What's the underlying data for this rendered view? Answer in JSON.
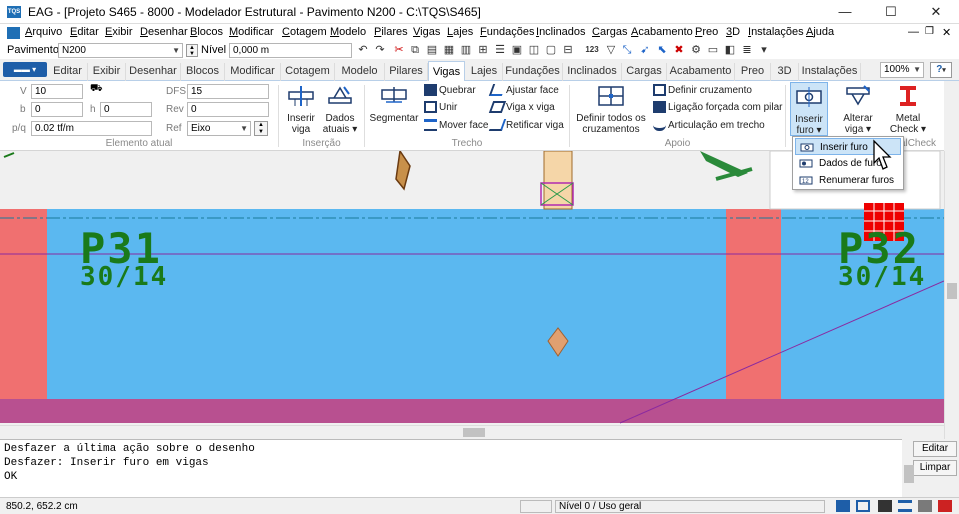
{
  "titlebar": {
    "title": "EAG - [Projeto S465 - 8000 - Modelador Estrutural - Pavimento N200 - C:\\TQS\\S465]",
    "app_icon": "TQS",
    "minimize": "—",
    "maximize": "☐",
    "close": "✕"
  },
  "menu": [
    "Arquivo",
    "Editar",
    "Exibir",
    "Desenhar",
    "Blocos",
    "Modificar",
    "Cotagem",
    "Modelo",
    "Pilares",
    "Vigas",
    "Lajes",
    "Fundações",
    "Inclinados",
    "Cargas",
    "Acabamento",
    "Preo",
    "3D",
    "Instalações",
    "Ajuda"
  ],
  "levelbar": {
    "pavimento_label": "Pavimento",
    "pavimento_value": "N200",
    "nivel_label": "Nível",
    "nivel_value": "0,000 m",
    "numbering_icon": "123"
  },
  "tabs": [
    "Editar",
    "Exibir",
    "Desenhar",
    "Blocos",
    "Modificar",
    "Cotagem",
    "Modelo",
    "Pilares",
    "Vigas",
    "Lajes",
    "Fundações",
    "Inclinados",
    "Cargas",
    "Acabamento",
    "Preo",
    "3D",
    "Instalações"
  ],
  "active_tab": "Vigas",
  "zoom": "100%",
  "help_btn": "?",
  "ribbon": {
    "elemento_atual": {
      "label": "Elemento atual",
      "v_label": "V",
      "v_value": "10",
      "b_label": "b",
      "b_value": "0",
      "h_label": "h",
      "h_value": "0",
      "pq_label": "p/q",
      "pq_value": "0.02 tf/m",
      "dfs_label": "DFS",
      "dfs_value": "15",
      "rev_label": "Rev",
      "rev_value": "0",
      "ref_label": "Ref",
      "ref_value": "Eixo"
    },
    "insercao": {
      "label": "Inserção",
      "inserir_viga": "Inserir viga",
      "dados_atuais": "Dados atuais ▾"
    },
    "trecho": {
      "label": "Trecho",
      "segmentar": "Segmentar",
      "quebrar": "Quebrar",
      "unir": "Unir",
      "mover_face": "Mover face",
      "ajustar_face": "Ajustar face",
      "viga_x_viga": "Viga x viga",
      "retificar_viga": "Retificar viga"
    },
    "apoio": {
      "label": "Apoio",
      "definir_todos": "Definir todos os cruzamentos",
      "definir_cruzamento": "Definir cruzamento",
      "ligacao_forcada": "Ligação forçada com pilar",
      "articulacao": "Articulação em trecho"
    },
    "furo": {
      "inserir_furo": "Inserir furo ▾",
      "alterar_viga": "Alterar viga ▾",
      "metal_check": "Metal Check ▾",
      "metalcheck_label": "alCheck"
    }
  },
  "dropdown": {
    "items": [
      "Inserir furo",
      "Dados de furo",
      "Renumerar furos"
    ]
  },
  "canvas": {
    "pillar1_name": "P31",
    "pillar1_size": "30/14",
    "pillar2_name": "P32",
    "pillar2_size": "30/14",
    "colors": {
      "beam": "#5bb8f0",
      "pillar": "#f07070",
      "slab": "#b85090",
      "text": "#1a7a1a"
    }
  },
  "command": {
    "lines": [
      "Desfazer a última ação sobre o desenho",
      "Desfazer:  Inserir furo em vigas",
      "OK"
    ],
    "edit_btn": "Editar",
    "clear_btn": "Limpar"
  },
  "status": {
    "coords": "850.2,   652.2 cm",
    "level": "Nível 0 / Uso geral"
  }
}
